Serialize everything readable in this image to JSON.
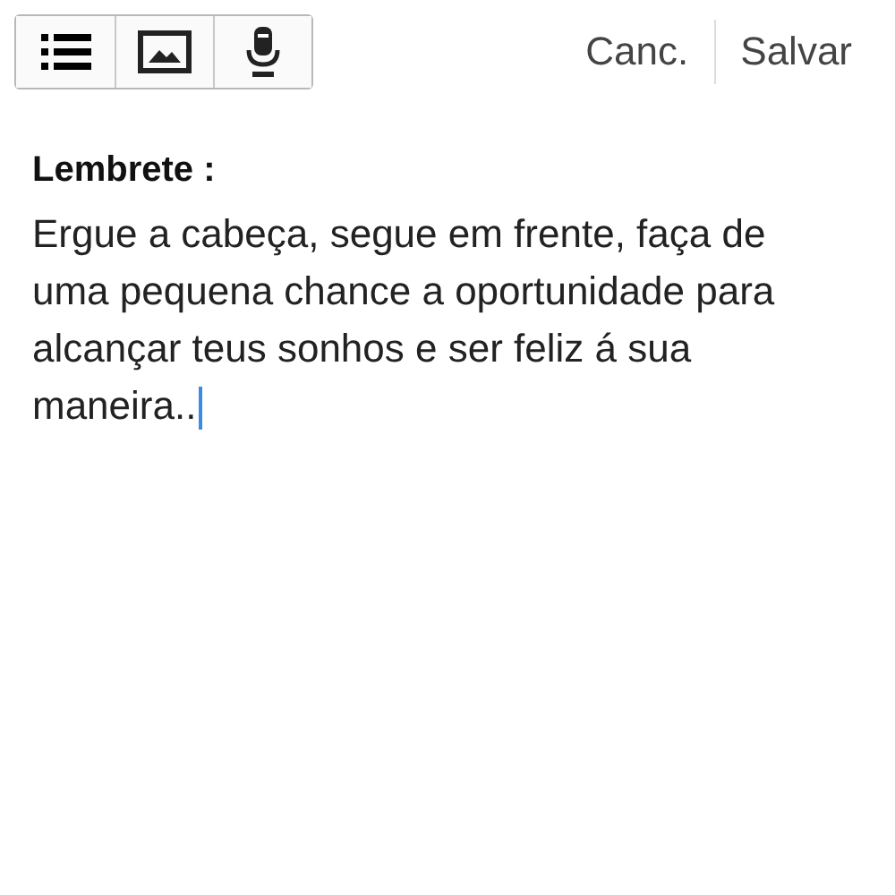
{
  "toolbar": {
    "actions": [
      {
        "label": "Canc."
      },
      {
        "label": "Salvar"
      }
    ]
  },
  "note": {
    "title": "Lembrete :",
    "body": "Ergue a cabeça, segue em frente, faça de uma pequena chance a oportunidade para alcançar teus sonhos e ser feliz á sua maneira.."
  }
}
